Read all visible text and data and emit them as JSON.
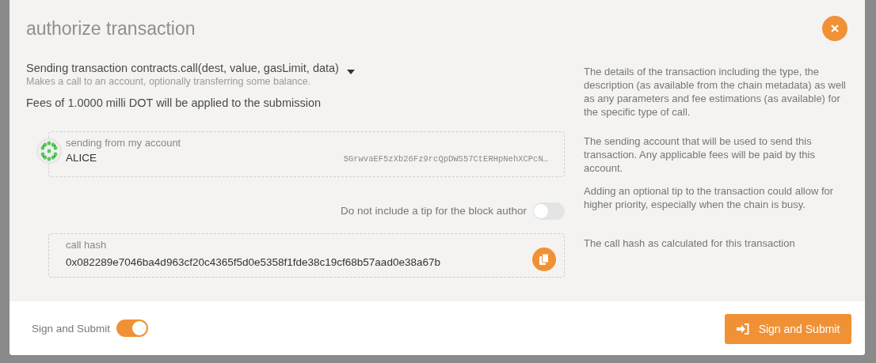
{
  "window": {
    "title": "authorize transaction"
  },
  "transaction": {
    "summary": "Sending transaction contracts.call(dest, value, gasLimit, data)",
    "description": "Makes a call to an account, optionally transferring some balance.",
    "fees": "Fees of 1.0000 milli DOT will be applied to the submission",
    "help": "The details of the transaction including the type, the description (as available from the chain metadata) as well as any parameters and fee estimations (as available) for the specific type of call."
  },
  "account": {
    "label": "sending from my account",
    "name": "ALICE",
    "address": "5GrwvaEF5zXb26Fz9rcQpDWS57CtERHpNehXCPcN…",
    "help": "The sending account that will be used to send this transaction. Any applicable fees will be paid by this account."
  },
  "tip": {
    "label": "Do not include a tip for the block author",
    "on": false,
    "help": "Adding an optional tip to the transaction could allow for higher priority, especially when the chain is busy."
  },
  "call_hash": {
    "label": "call hash",
    "value": "0x082289e7046ba4d963cf20c4365f5d0e5358f1fde38c19cf68b57aad0e38a67b",
    "help": "The call hash as calculated for this transaction"
  },
  "footer": {
    "toggle_label": "Sign and Submit",
    "toggle_on": true,
    "button": "Sign and Submit"
  }
}
